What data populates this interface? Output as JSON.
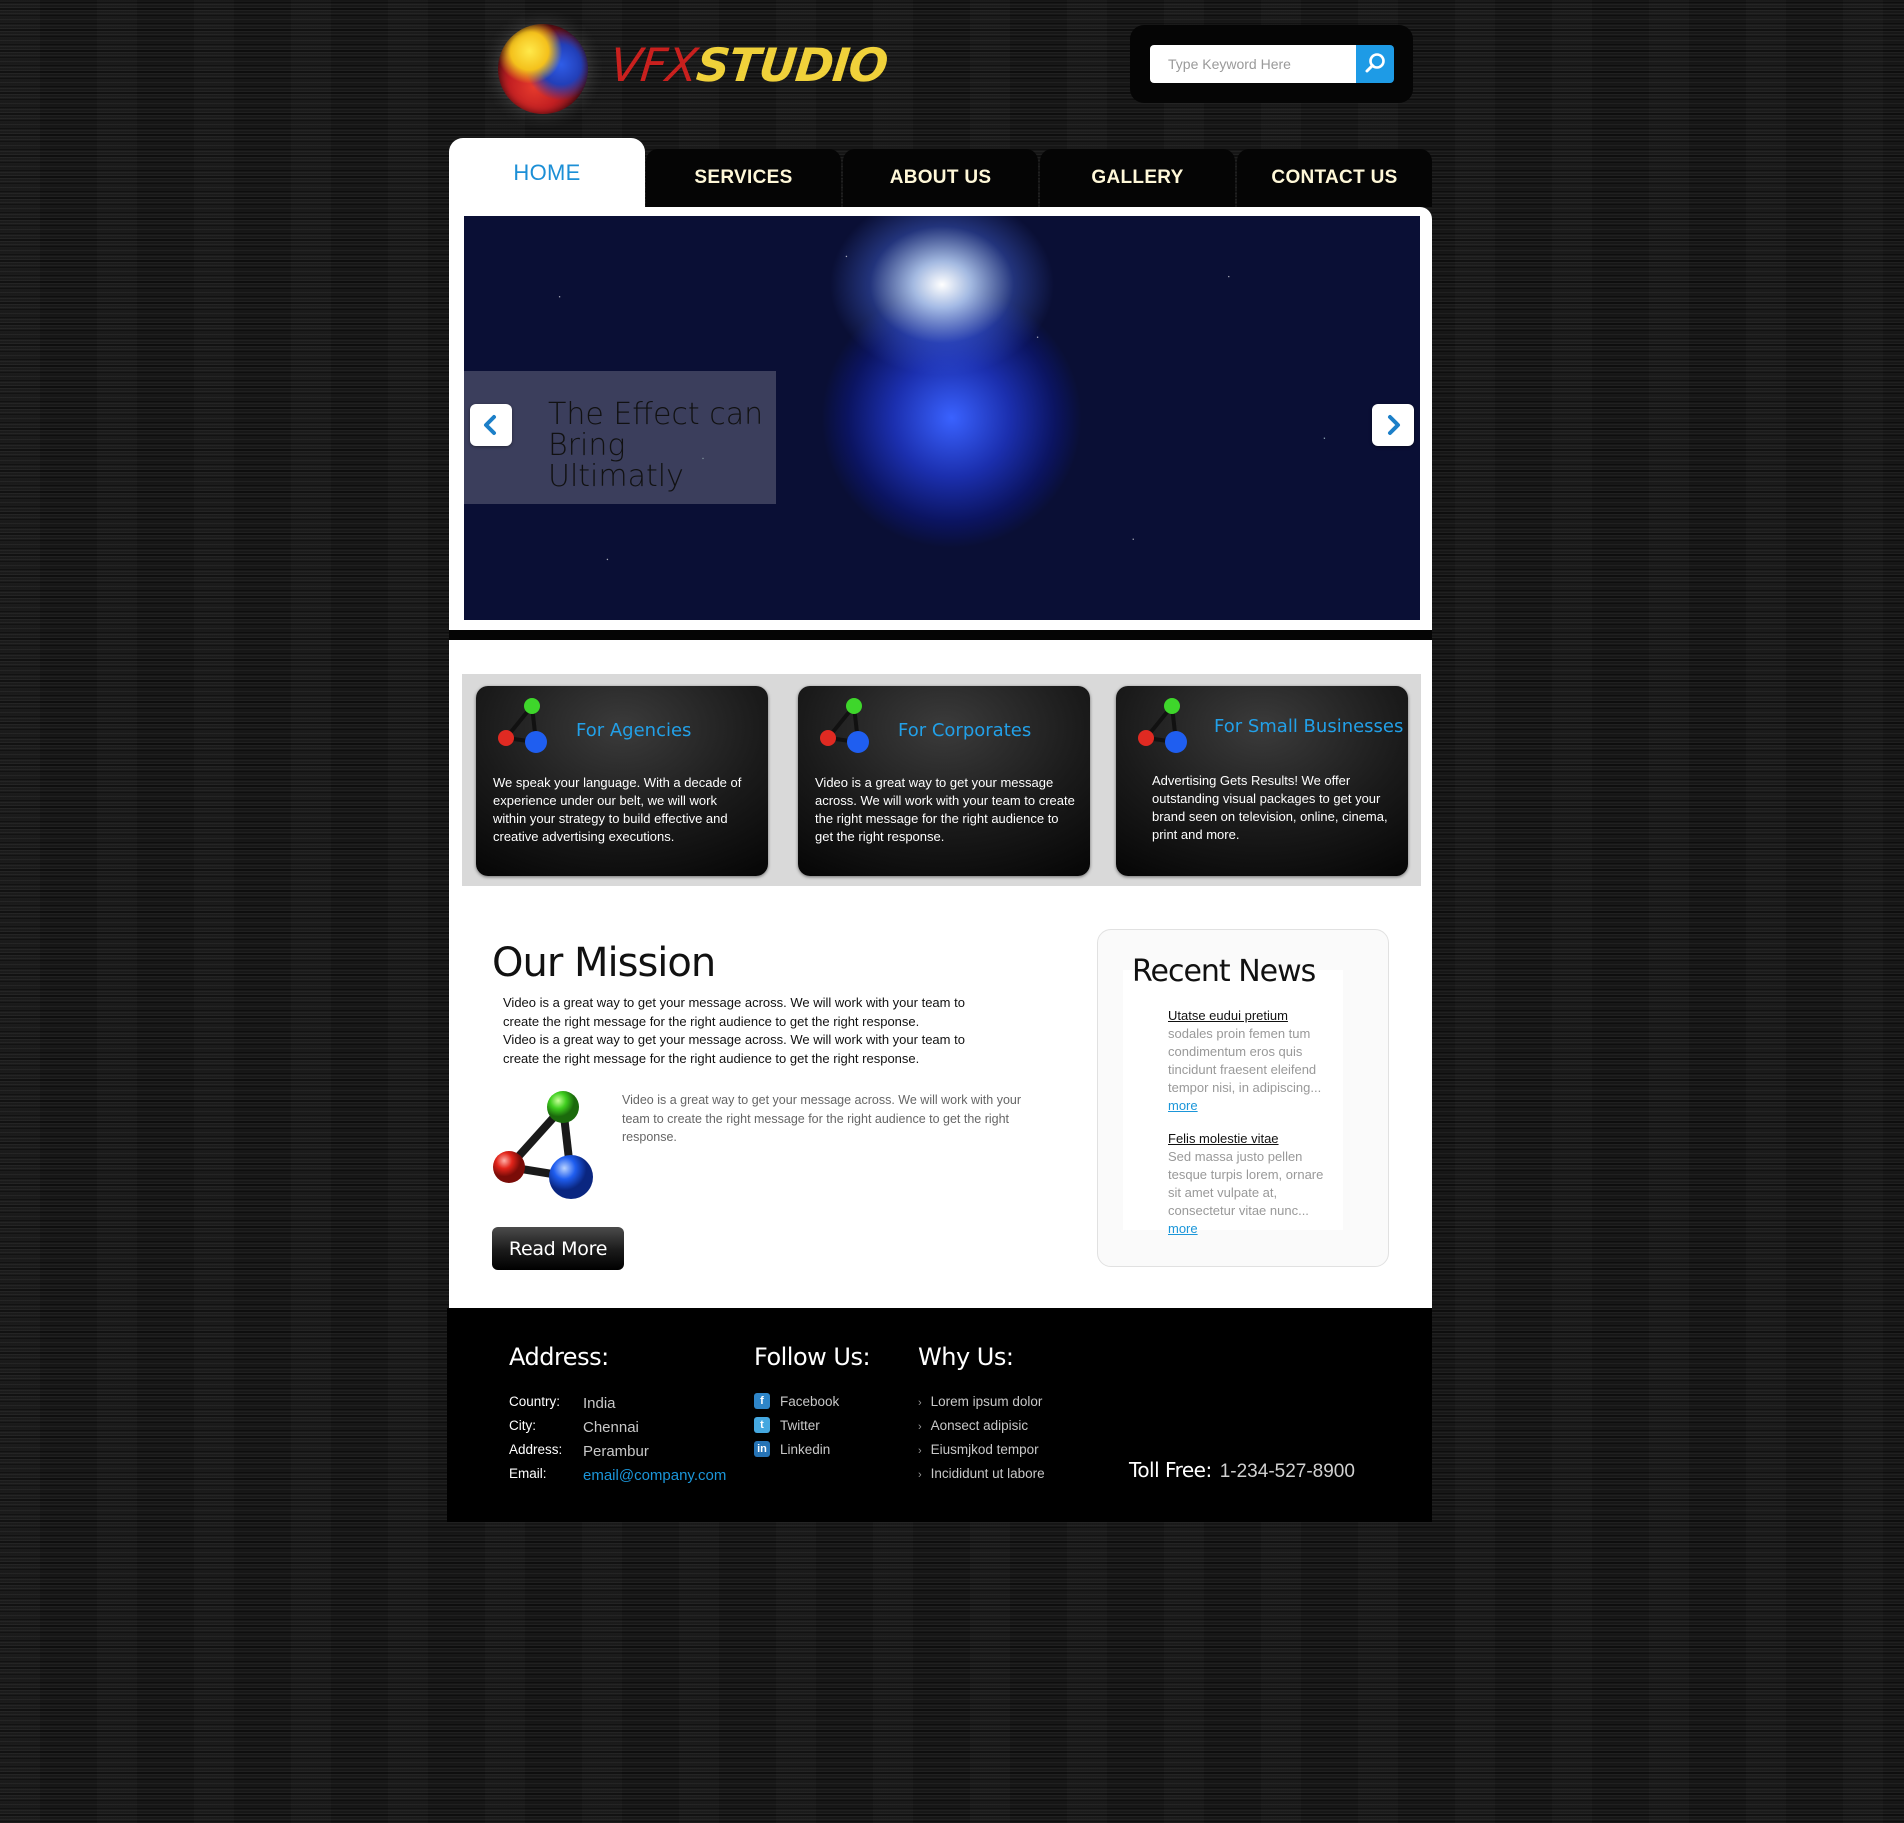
{
  "header": {
    "logo_prefix": "VFX",
    "logo_suffix": "STUDIO",
    "search": {
      "placeholder": "Type Keyword Here",
      "icon": "search-icon"
    }
  },
  "nav": {
    "items": [
      {
        "label": "HOME",
        "active": true
      },
      {
        "label": "SERVICES"
      },
      {
        "label": "ABOUT US"
      },
      {
        "label": "GALLERY"
      },
      {
        "label": "CONTACT US"
      }
    ]
  },
  "slider": {
    "caption_line1": "The Effect can",
    "caption_line2": "Bring Ultimatly",
    "prev_icon": "chevron-left-icon",
    "next_icon": "chevron-right-icon"
  },
  "features": [
    {
      "title": "For Agencies",
      "text": "We speak your language. With a decade of experience under our belt, we will work within your strategy to build effective and creative advertising executions."
    },
    {
      "title": "For Corporates",
      "text": "Video is a great way to get your message across. We will work with your team to create the right message for the right audience to get the right response."
    },
    {
      "title": "For Small Businesses",
      "text": "Advertising Gets Results! We offer outstanding visual packages to get your brand seen on television, online, cinema, print and more."
    }
  ],
  "mission": {
    "title": "Our Mission",
    "para1_line1": "Video is a great way to get your message across. We will work with your team to",
    "para1_line2": "create the right message for the right  audience to get the right response.",
    "para2_line1": "Video is a great way to get your message across. We will work with your team to",
    "para2_line2": "create the right message for the right  audience to get the right response.",
    "aside": "Video is a great way to get your message across. We will work with your team to create the right message for the right audience to get the right response.",
    "read_more": "Read More"
  },
  "news": {
    "title": "Recent News",
    "items": [
      {
        "heading": "Utatse eudui pretium",
        "body": "sodales proin femen tum condimentum eros quis tincidunt fraesent eleifend tempor nisi, in adipiscing...",
        "more": "more"
      },
      {
        "heading": "Felis molestie vitae",
        "body": "Sed massa justo pellen tesque turpis lorem, ornare sit amet vulpate at, consectetur vitae nunc...",
        "more": "more"
      }
    ]
  },
  "footer": {
    "address": {
      "title": "Address:",
      "country_label": "Country:",
      "country": "India",
      "city_label": "City:",
      "city": "Chennai",
      "address_label": "Address:",
      "address": "Perambur",
      "email_label": "Email:",
      "email": "email@company.com"
    },
    "follow": {
      "title": "Follow Us:",
      "links": [
        "Facebook",
        "Twitter",
        "Linkedin"
      ]
    },
    "why": {
      "title": "Why Us:",
      "items": [
        "Lorem ipsum dolor",
        "Aonsect adipisic",
        "Eiusmjkod tempor",
        "Incididunt ut labore"
      ]
    },
    "toll": {
      "label": "Toll Free:",
      "number": "1-234-527-8900"
    }
  },
  "colors": {
    "accent": "#1c8fd6",
    "nav_text": "#fff8d8",
    "logo_red": "#c9201e",
    "logo_yellow": "#f0d13a"
  }
}
